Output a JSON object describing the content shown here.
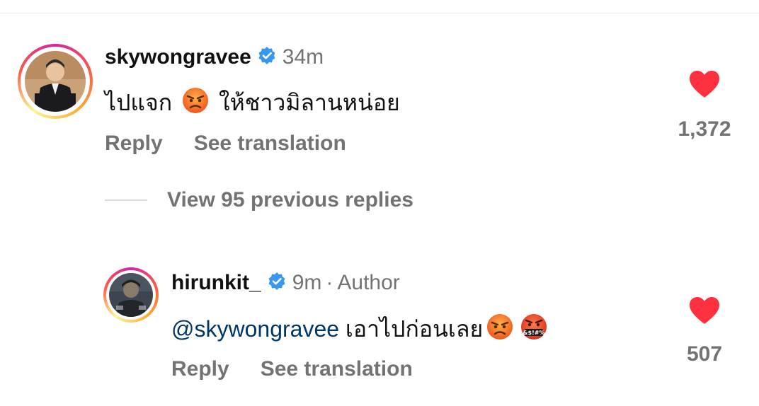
{
  "comment1": {
    "username": "skywongravee",
    "time": "34m",
    "text_before": "ไปแจก",
    "text_after": "ให้ชาวมิลานหน่อย",
    "reply_label": "Reply",
    "translate_label": "See translation",
    "like_count": "1,372"
  },
  "view_replies": {
    "label": "View 95 previous replies"
  },
  "comment2": {
    "username": "hirunkit_",
    "time": "9m",
    "separator": "·",
    "author_label": "Author",
    "mention": "@skywongravee",
    "text": "เอาไปก่อนเลย",
    "reply_label": "Reply",
    "translate_label": "See translation",
    "like_count": "507"
  },
  "emoji_symbols_text": "&$!#%",
  "colors": {
    "verified": "#3897f0",
    "heart": "#ff3040",
    "mention": "#00376b",
    "muted": "#737373"
  },
  "icons": [
    "verified-badge-icon",
    "heart-icon",
    "angry-face-emoji",
    "cursing-face-emoji"
  ]
}
